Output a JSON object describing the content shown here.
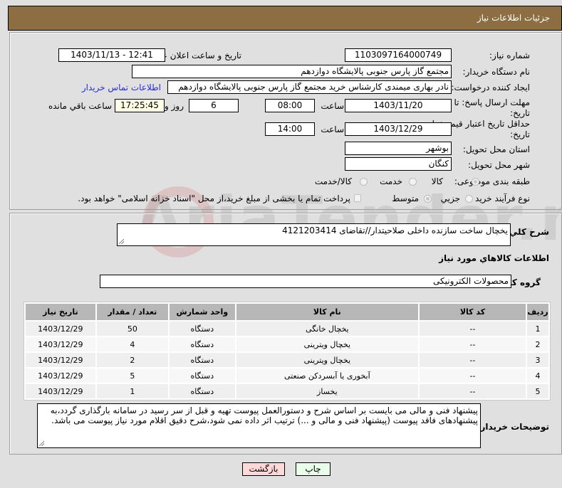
{
  "header": {
    "title": "جزئیات اطلاعات نیاز"
  },
  "form": {
    "need_number_label": "شماره نیاز:",
    "need_number": "1103097164000749",
    "announce_label": "تاریخ و ساعت اعلان عمومي:",
    "announce_value": "1403/11/13 - 12:41",
    "buyer_org_label": "نام دستگاه خریدار:",
    "buyer_org": "مجتمع گاز پارس جنوبی  پالایشگاه دوازدهم",
    "creator_label": "ایجاد کننده درخواست:",
    "creator": "نادر بهاری میمندی کارشناس خرید مجتمع گاز پارس جنوبی  پالایشگاه دوازدهم",
    "contact_link": "اطلاعات تماس خریدار",
    "reply_deadline_label_1": "مهلت ارسال پاسخ: تا",
    "reply_deadline_label_2": "تاریخ:",
    "reply_date": "1403/11/20",
    "time_label": "ساعت",
    "reply_time": "08:00",
    "days_value": "6",
    "days_label": "روز و",
    "remaining_time": "17:25:45",
    "remaining_label": "ساعت باقي مانده",
    "price_validity_label_1": "حداقل تاریخ اعتبار قیمت: تا",
    "price_validity_label_2": "تاریخ:",
    "price_validity_date": "1403/12/29",
    "price_validity_time": "14:00",
    "province_label": "استان محل تحویل:",
    "province": "بوشهر",
    "city_label": "شهر محل تحویل:",
    "city": "کنگان",
    "category_label": "طبقه بندی موضوعی:",
    "category_options": [
      "کالا",
      "خدمت",
      "کالا/خدمت"
    ],
    "category_selected": "کالا",
    "process_label": "نوع فرآیند خرید :",
    "process_options": [
      "جزیي",
      "متوسط"
    ],
    "process_selected": "متوسط",
    "treasury_note": "پرداخت تمام یا بخشی از مبلغ خرید،از محل \"اسناد خزانه اسلامی\" خواهد بود."
  },
  "description": {
    "label": "شرح کلي نياز:",
    "value": "یخچال ساخت سازنده داخلی صلاحیتدار//تقاضای 4121203414"
  },
  "goods_section": {
    "title": "اطلاعات کالاهاي مورد نياز",
    "group_label": "گروه کالا:",
    "group_value": "محصولات الکترونیکی"
  },
  "table": {
    "headers": [
      "ردیف",
      "کد کالا",
      "نام کالا",
      "واحد شمارش",
      "تعداد / مقدار",
      "تاریخ نیاز"
    ],
    "rows": [
      {
        "row": "1",
        "code": "--",
        "name": "یخچال خانگی",
        "unit": "دستگاه",
        "qty": "50",
        "date": "1403/12/29"
      },
      {
        "row": "2",
        "code": "--",
        "name": "یخچال ویترینی",
        "unit": "دستگاه",
        "qty": "4",
        "date": "1403/12/29"
      },
      {
        "row": "3",
        "code": "--",
        "name": "یخچال ویترینی",
        "unit": "دستگاه",
        "qty": "2",
        "date": "1403/12/29"
      },
      {
        "row": "4",
        "code": "--",
        "name": "آبخوری یا آبسردکن صنعتی",
        "unit": "دستگاه",
        "qty": "5",
        "date": "1403/12/29"
      },
      {
        "row": "5",
        "code": "--",
        "name": "یخساز",
        "unit": "دستگاه",
        "qty": "1",
        "date": "1403/12/29"
      }
    ]
  },
  "buyer_notes": {
    "label": "توضیحات خریدار:",
    "value": "پیشنهاد فنی و مالی می بایست بر اساس شرح و دستورالعمل پیوست تهیه و قبل از سر رسید در سامانه بارگذاری گردد،به پیشنهادهای فاقد پیوست (پیشنهاد فنی و مالی و ...) ترتیب اثر داده نمی شود،شرح دقیق اقلام مورد نیاز پیوست می باشد."
  },
  "buttons": {
    "print": "چاپ",
    "back": "بازگشت"
  },
  "watermark": "AriaTender.net",
  "colors": {
    "header_bg": "#8d6e42",
    "link": "#2a2ad6",
    "print_bg": "#eaffea",
    "back_bg": "#ffd9d9",
    "remaining_bg": "#ffffe6"
  }
}
